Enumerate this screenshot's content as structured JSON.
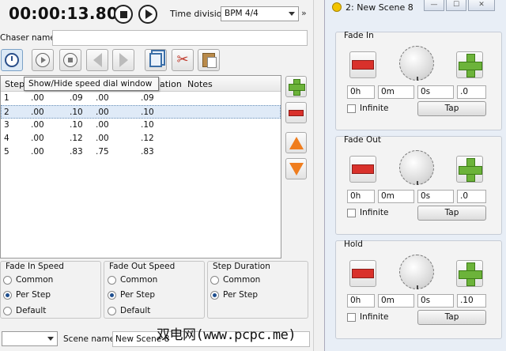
{
  "timer": {
    "display": "00:00:13.80"
  },
  "time_division": {
    "label": "Time division:",
    "value": "BPM 4/4"
  },
  "more_label": "»",
  "chaser": {
    "name_label": "Chaser name",
    "name_value": ""
  },
  "tooltip": "Show/Hide speed dial window",
  "table": {
    "headers": {
      "step": "Step",
      "duration_fragment": "ation",
      "notes": "Notes"
    },
    "rows": [
      {
        "step": "1",
        "fade_in": ".00",
        "hold": ".09",
        "fade_out": ".00",
        "duration": ".09",
        "selected": false
      },
      {
        "step": "2",
        "fade_in": ".00",
        "hold": ".10",
        "fade_out": ".00",
        "duration": ".10",
        "selected": true
      },
      {
        "step": "3",
        "fade_in": ".00",
        "hold": ".10",
        "fade_out": ".00",
        "duration": ".10",
        "selected": false
      },
      {
        "step": "4",
        "fade_in": ".00",
        "hold": ".12",
        "fade_out": ".00",
        "duration": ".12",
        "selected": false
      },
      {
        "step": "5",
        "fade_in": ".00",
        "hold": ".83",
        "fade_out": ".75",
        "duration": ".83",
        "selected": false
      }
    ]
  },
  "speed_groups": {
    "fade_in": {
      "title": "Fade In Speed",
      "options": [
        "Common",
        "Per Step",
        "Default"
      ],
      "selected": "Per Step"
    },
    "fade_out": {
      "title": "Fade Out Speed",
      "options": [
        "Common",
        "Per Step",
        "Default"
      ],
      "selected": "Per Step"
    },
    "step_duration": {
      "title": "Step Duration",
      "options": [
        "Common",
        "Per Step"
      ],
      "selected": "Per Step"
    }
  },
  "scene": {
    "label": "Scene name:",
    "value": "New Scene 8"
  },
  "speed_window": {
    "title": "2: New Scene 8",
    "buttons": {
      "minimize": "—",
      "maximize": "☐",
      "close": "✕"
    },
    "panels": [
      {
        "title": "Fade In",
        "hours": "0h",
        "minutes": "0m",
        "seconds": "0s",
        "ms": ".0",
        "infinite_label": "Infinite",
        "tap_label": "Tap"
      },
      {
        "title": "Fade Out",
        "hours": "0h",
        "minutes": "0m",
        "seconds": "0s",
        "ms": ".0",
        "infinite_label": "Infinite",
        "tap_label": "Tap"
      },
      {
        "title": "Hold",
        "hours": "0h",
        "minutes": "0m",
        "seconds": "0s",
        "ms": ".10",
        "infinite_label": "Infinite",
        "tap_label": "Tap"
      }
    ]
  },
  "watermark": "双电网(www.pcpc.me)",
  "colors": {
    "add": "#6cb33a",
    "remove": "#d9312b",
    "move": "#ef7d1e",
    "selection": "#dfeaf7"
  }
}
